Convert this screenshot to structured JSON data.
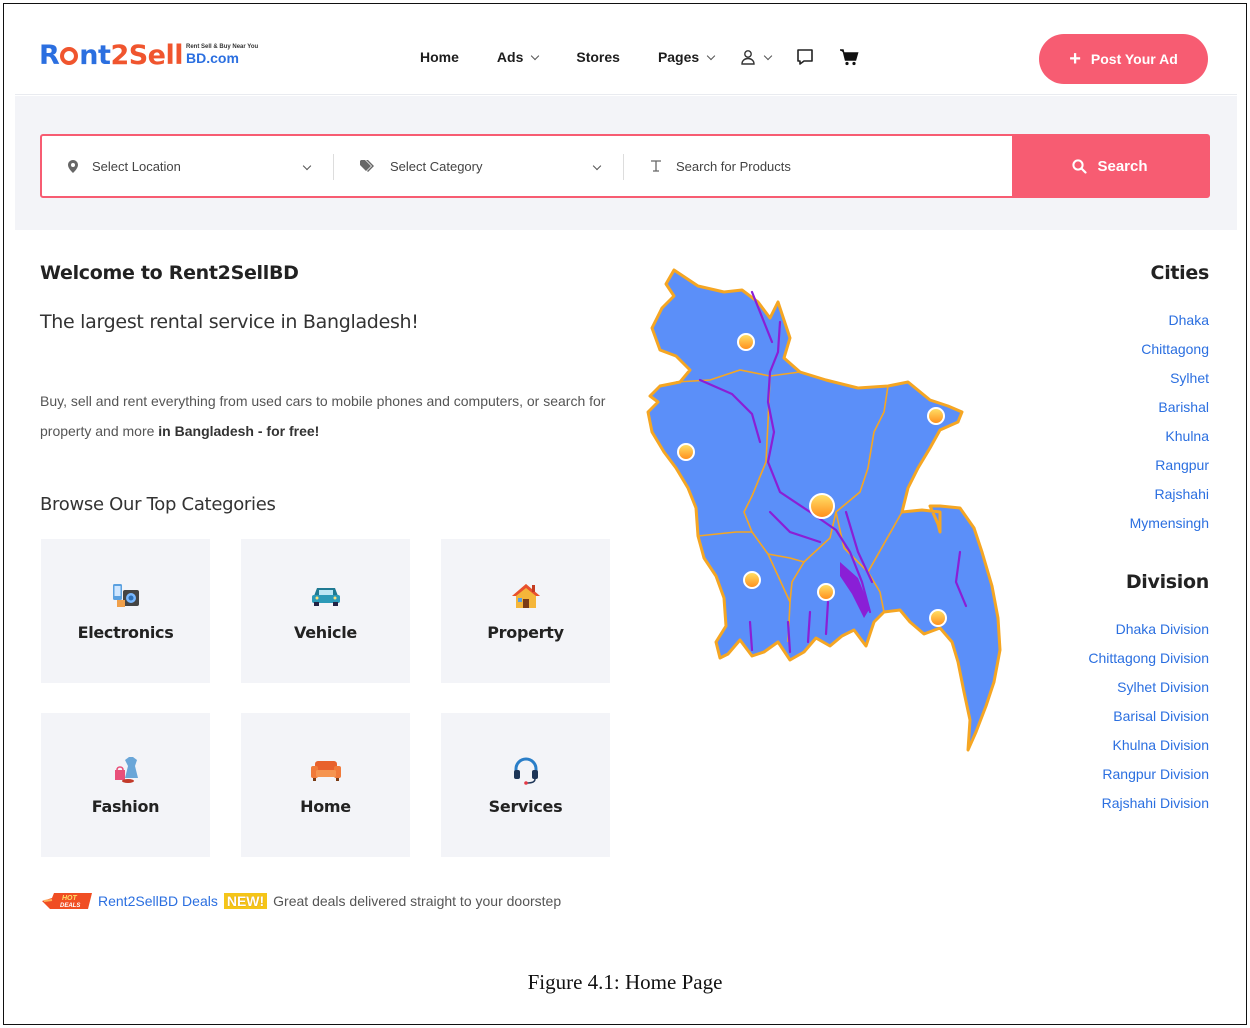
{
  "header": {
    "logo": {
      "r": "R",
      "nt": "nt",
      "two": "2",
      "sell": "Sell",
      "tag": "Rent Sell & Buy Near You",
      "bd": "BD.com"
    },
    "nav": {
      "home": "Home",
      "ads": "Ads",
      "stores": "Stores",
      "pages": "Pages"
    },
    "icons": [
      "user-icon",
      "chat-icon",
      "cart-icon"
    ],
    "post_ad": "Post Your Ad"
  },
  "search": {
    "location_placeholder": "Select Location",
    "category_placeholder": "Select Category",
    "product_placeholder": "Search for Products",
    "button": "Search"
  },
  "intro": {
    "welcome": "Welcome to Rent2SellBD",
    "tagline": "The largest rental service in Bangladesh!",
    "desc_plain": "Buy, sell and rent everything from used cars to mobile phones and computers, or search for property and more ",
    "desc_bold": "in Bangladesh - for free!"
  },
  "categories": {
    "title": "Browse Our Top Categories",
    "items": [
      {
        "label": "Electronics",
        "icon": "electronics-icon"
      },
      {
        "label": "Vehicle",
        "icon": "car-icon"
      },
      {
        "label": "Property",
        "icon": "house-icon"
      },
      {
        "label": "Fashion",
        "icon": "fashion-icon"
      },
      {
        "label": "Home",
        "icon": "sofa-icon"
      },
      {
        "label": "Services",
        "icon": "headset-icon"
      }
    ]
  },
  "deals": {
    "hot_badge": "HOT DEALS",
    "link": "Rent2SellBD Deals",
    "new_badge": "NEW!",
    "text": "Great deals delivered straight to your doorstep"
  },
  "cities": {
    "title": "Cities",
    "items": [
      "Dhaka",
      "Chittagong",
      "Sylhet",
      "Barishal",
      "Khulna",
      "Rangpur",
      "Rajshahi",
      "Mymensingh"
    ]
  },
  "divisions": {
    "title": "Division",
    "items": [
      "Dhaka Division",
      "Chittagong Division",
      "Sylhet Division",
      "Barisal Division",
      "Khulna Division",
      "Rangpur Division",
      "Rajshahi Division"
    ]
  },
  "caption": "Figure 4.1: Home Page",
  "colors": {
    "accent": "#f75c72",
    "link": "#2b6fe0",
    "map_fill": "#5b8ff9",
    "map_border": "#f5a623",
    "river": "#8a1fd6"
  }
}
